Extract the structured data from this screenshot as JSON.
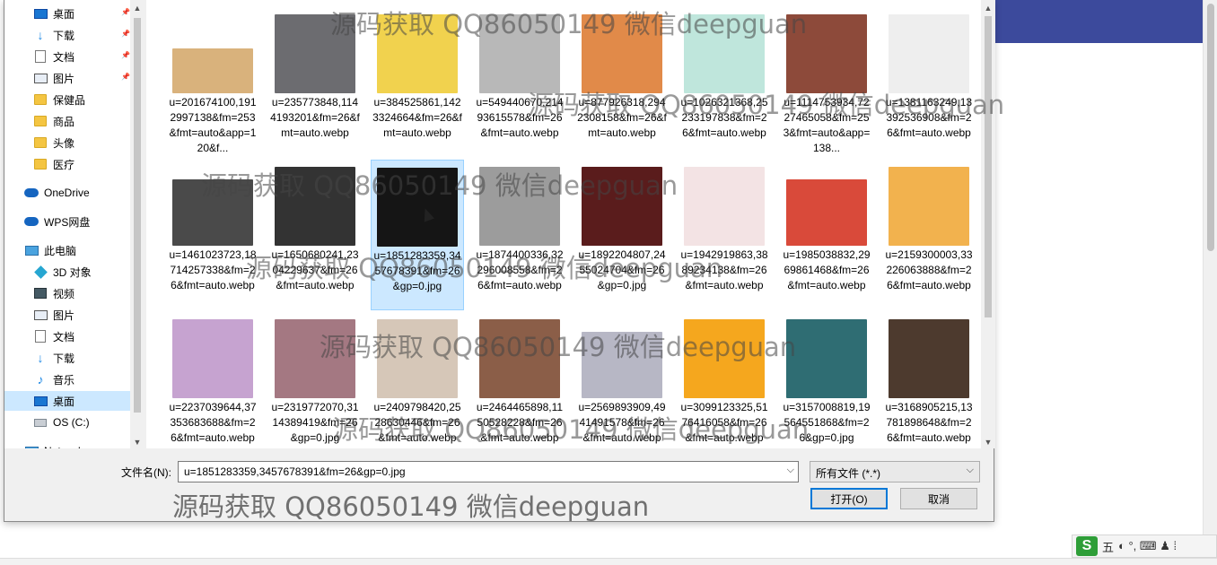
{
  "watermark": "源码获取 QQ86050149 微信deepguan",
  "nav": {
    "items": [
      {
        "label": "桌面",
        "icon": "desktop-icon",
        "pinned": true
      },
      {
        "label": "下载",
        "icon": "download-icon",
        "pinned": true
      },
      {
        "label": "文档",
        "icon": "document-icon",
        "pinned": true
      },
      {
        "label": "图片",
        "icon": "pictures-icon",
        "pinned": true
      },
      {
        "label": "保健品",
        "icon": "folder-icon"
      },
      {
        "label": "商品",
        "icon": "folder-icon"
      },
      {
        "label": "头像",
        "icon": "folder-icon"
      },
      {
        "label": "医疗",
        "icon": "folder-icon"
      },
      {
        "label": "OneDrive",
        "icon": "onedrive-icon"
      },
      {
        "label": "WPS网盘",
        "icon": "wps-cloud-icon"
      },
      {
        "label": "此电脑",
        "icon": "this-pc-icon"
      },
      {
        "label": "3D 对象",
        "icon": "3d-objects-icon"
      },
      {
        "label": "视频",
        "icon": "video-icon"
      },
      {
        "label": "图片",
        "icon": "pictures-icon"
      },
      {
        "label": "文档",
        "icon": "document-icon"
      },
      {
        "label": "下载",
        "icon": "download-icon"
      },
      {
        "label": "音乐",
        "icon": "music-icon"
      },
      {
        "label": "桌面",
        "icon": "desktop-icon",
        "selected": true
      },
      {
        "label": "OS (C:)",
        "icon": "drive-icon"
      },
      {
        "label": "Network",
        "icon": "network-icon"
      }
    ]
  },
  "files": [
    {
      "name": "u=201674100,1912997138&fm=253&fmt=auto&app=120&f...",
      "color": "#d9b27c",
      "shape": "short"
    },
    {
      "name": "u=235773848,1144193201&fm=26&fmt=auto.webp",
      "color": "#6c6c70"
    },
    {
      "name": "u=384525861,1423324664&fm=26&fmt=auto.webp",
      "color": "#f1d24e"
    },
    {
      "name": "u=549440670,21493615578&fm=26&fmt=auto.webp",
      "color": "#b8b8b8"
    },
    {
      "name": "u=877926318,2942308158&fm=26&fmt=auto.webp",
      "color": "#e18a49"
    },
    {
      "name": "u=1026321368,25233197838&fm=26&fmt=auto.webp",
      "color": "#bfe6dc"
    },
    {
      "name": "u=1114753934,7227465058&fm=253&fmt=auto&app=138...",
      "color": "#8d4a3a"
    },
    {
      "name": "u=1381163249,13392536908&fm=26&fmt=auto.webp",
      "color": "#eeeeee"
    },
    {
      "name": "u=1461023723,18714257338&fm=26&fmt=auto.webp",
      "color": "#4a4a4a",
      "shape": "mid"
    },
    {
      "name": "u=1650680241,2304229637&fm=26&fmt=auto.webp",
      "color": "#333333"
    },
    {
      "name": "u=1851283359,3457678391&fm=26&gp=0.jpg",
      "color": "#151515",
      "selected": true
    },
    {
      "name": "u=1874400336,32296008558&fm=26&fmt=auto.webp",
      "color": "#9c9c9c"
    },
    {
      "name": "u=1892204807,2455024704&fm=26&gp=0.jpg",
      "color": "#5a1c1c"
    },
    {
      "name": "u=1942919863,3889234138&fm=26&fmt=auto.webp",
      "color": "#f3e3e4"
    },
    {
      "name": "u=1985038832,2969861468&fm=26&fmt=auto.webp",
      "color": "#d94a3a",
      "shape": "mid"
    },
    {
      "name": "u=2159300003,33226063888&fm=26&fmt=auto.webp",
      "color": "#f2b24e"
    },
    {
      "name": "u=2237039644,37353683688&fm=26&fmt=auto.webp",
      "color": "#c6a3d0"
    },
    {
      "name": "u=2319772070,3114389419&fm=26&gp=0.jpg",
      "color": "#a47882"
    },
    {
      "name": "u=2409798420,2528630446&fm=26&fmt=auto.webp",
      "color": "#d6c7b8"
    },
    {
      "name": "u=2464465898,1150528228&fm=26&fmt=auto.webp",
      "color": "#8b5e48"
    },
    {
      "name": "u=2569893909,4941491578&fm=26&fmt=auto.webp",
      "color": "#b7b7c5",
      "shape": "mid"
    },
    {
      "name": "u=3099123325,5176416058&fm=26&fmt=auto.webp",
      "color": "#f5a71e"
    },
    {
      "name": "u=3157008819,19564551868&fm=26&gp=0.jpg",
      "color": "#2f6d73"
    },
    {
      "name": "u=3168905215,13781898648&fm=26&fmt=auto.webp",
      "color": "#4d3a2e"
    }
  ],
  "filename": {
    "label": "文件名(N):",
    "value": "u=1851283359,3457678391&fm=26&gp=0.jpg"
  },
  "filetype": {
    "value": "所有文件 (*.*)"
  },
  "buttons": {
    "open": "打开(O)",
    "cancel": "取消"
  },
  "tray": {
    "ime_logo": "S",
    "ime_mode": "五",
    "symbols": "◐ °, ⌨ ♟ ⁞"
  }
}
